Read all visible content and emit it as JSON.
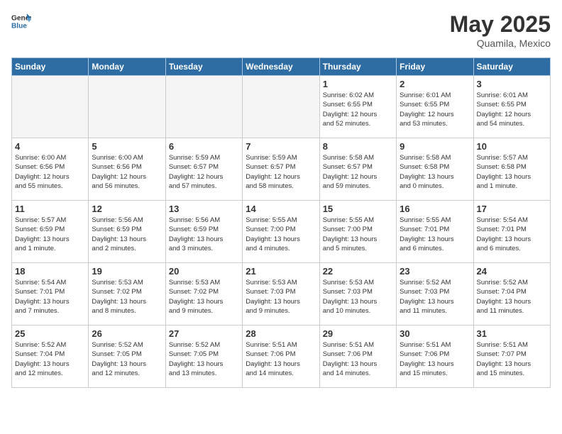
{
  "header": {
    "logo_line1": "General",
    "logo_line2": "Blue",
    "month_year": "May 2025",
    "location": "Quamila, Mexico"
  },
  "days_of_week": [
    "Sunday",
    "Monday",
    "Tuesday",
    "Wednesday",
    "Thursday",
    "Friday",
    "Saturday"
  ],
  "weeks": [
    [
      {
        "day": "",
        "info": ""
      },
      {
        "day": "",
        "info": ""
      },
      {
        "day": "",
        "info": ""
      },
      {
        "day": "",
        "info": ""
      },
      {
        "day": "1",
        "info": "Sunrise: 6:02 AM\nSunset: 6:55 PM\nDaylight: 12 hours\nand 52 minutes."
      },
      {
        "day": "2",
        "info": "Sunrise: 6:01 AM\nSunset: 6:55 PM\nDaylight: 12 hours\nand 53 minutes."
      },
      {
        "day": "3",
        "info": "Sunrise: 6:01 AM\nSunset: 6:55 PM\nDaylight: 12 hours\nand 54 minutes."
      }
    ],
    [
      {
        "day": "4",
        "info": "Sunrise: 6:00 AM\nSunset: 6:56 PM\nDaylight: 12 hours\nand 55 minutes."
      },
      {
        "day": "5",
        "info": "Sunrise: 6:00 AM\nSunset: 6:56 PM\nDaylight: 12 hours\nand 56 minutes."
      },
      {
        "day": "6",
        "info": "Sunrise: 5:59 AM\nSunset: 6:57 PM\nDaylight: 12 hours\nand 57 minutes."
      },
      {
        "day": "7",
        "info": "Sunrise: 5:59 AM\nSunset: 6:57 PM\nDaylight: 12 hours\nand 58 minutes."
      },
      {
        "day": "8",
        "info": "Sunrise: 5:58 AM\nSunset: 6:57 PM\nDaylight: 12 hours\nand 59 minutes."
      },
      {
        "day": "9",
        "info": "Sunrise: 5:58 AM\nSunset: 6:58 PM\nDaylight: 13 hours\nand 0 minutes."
      },
      {
        "day": "10",
        "info": "Sunrise: 5:57 AM\nSunset: 6:58 PM\nDaylight: 13 hours\nand 1 minute."
      }
    ],
    [
      {
        "day": "11",
        "info": "Sunrise: 5:57 AM\nSunset: 6:59 PM\nDaylight: 13 hours\nand 1 minute."
      },
      {
        "day": "12",
        "info": "Sunrise: 5:56 AM\nSunset: 6:59 PM\nDaylight: 13 hours\nand 2 minutes."
      },
      {
        "day": "13",
        "info": "Sunrise: 5:56 AM\nSunset: 6:59 PM\nDaylight: 13 hours\nand 3 minutes."
      },
      {
        "day": "14",
        "info": "Sunrise: 5:55 AM\nSunset: 7:00 PM\nDaylight: 13 hours\nand 4 minutes."
      },
      {
        "day": "15",
        "info": "Sunrise: 5:55 AM\nSunset: 7:00 PM\nDaylight: 13 hours\nand 5 minutes."
      },
      {
        "day": "16",
        "info": "Sunrise: 5:55 AM\nSunset: 7:01 PM\nDaylight: 13 hours\nand 6 minutes."
      },
      {
        "day": "17",
        "info": "Sunrise: 5:54 AM\nSunset: 7:01 PM\nDaylight: 13 hours\nand 6 minutes."
      }
    ],
    [
      {
        "day": "18",
        "info": "Sunrise: 5:54 AM\nSunset: 7:01 PM\nDaylight: 13 hours\nand 7 minutes."
      },
      {
        "day": "19",
        "info": "Sunrise: 5:53 AM\nSunset: 7:02 PM\nDaylight: 13 hours\nand 8 minutes."
      },
      {
        "day": "20",
        "info": "Sunrise: 5:53 AM\nSunset: 7:02 PM\nDaylight: 13 hours\nand 9 minutes."
      },
      {
        "day": "21",
        "info": "Sunrise: 5:53 AM\nSunset: 7:03 PM\nDaylight: 13 hours\nand 9 minutes."
      },
      {
        "day": "22",
        "info": "Sunrise: 5:53 AM\nSunset: 7:03 PM\nDaylight: 13 hours\nand 10 minutes."
      },
      {
        "day": "23",
        "info": "Sunrise: 5:52 AM\nSunset: 7:03 PM\nDaylight: 13 hours\nand 11 minutes."
      },
      {
        "day": "24",
        "info": "Sunrise: 5:52 AM\nSunset: 7:04 PM\nDaylight: 13 hours\nand 11 minutes."
      }
    ],
    [
      {
        "day": "25",
        "info": "Sunrise: 5:52 AM\nSunset: 7:04 PM\nDaylight: 13 hours\nand 12 minutes."
      },
      {
        "day": "26",
        "info": "Sunrise: 5:52 AM\nSunset: 7:05 PM\nDaylight: 13 hours\nand 12 minutes."
      },
      {
        "day": "27",
        "info": "Sunrise: 5:52 AM\nSunset: 7:05 PM\nDaylight: 13 hours\nand 13 minutes."
      },
      {
        "day": "28",
        "info": "Sunrise: 5:51 AM\nSunset: 7:06 PM\nDaylight: 13 hours\nand 14 minutes."
      },
      {
        "day": "29",
        "info": "Sunrise: 5:51 AM\nSunset: 7:06 PM\nDaylight: 13 hours\nand 14 minutes."
      },
      {
        "day": "30",
        "info": "Sunrise: 5:51 AM\nSunset: 7:06 PM\nDaylight: 13 hours\nand 15 minutes."
      },
      {
        "day": "31",
        "info": "Sunrise: 5:51 AM\nSunset: 7:07 PM\nDaylight: 13 hours\nand 15 minutes."
      }
    ]
  ]
}
